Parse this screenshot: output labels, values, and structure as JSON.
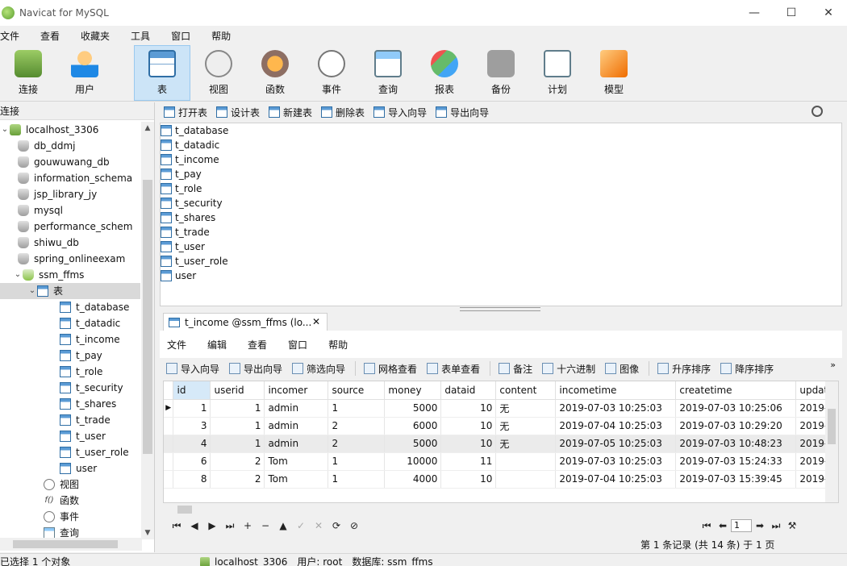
{
  "window": {
    "title": "Navicat for MySQL",
    "minimize": "—",
    "maximize": "☐",
    "close": "✕"
  },
  "menu": [
    "文件",
    "查看",
    "收藏夹",
    "工具",
    "窗口",
    "帮助"
  ],
  "toolbar": [
    {
      "label": "连接",
      "icon": "connection-icon"
    },
    {
      "label": "用户",
      "icon": "user-icon"
    },
    {
      "label": "表",
      "icon": "table-icon"
    },
    {
      "label": "视图",
      "icon": "view-icon"
    },
    {
      "label": "函数",
      "icon": "function-icon"
    },
    {
      "label": "事件",
      "icon": "event-icon"
    },
    {
      "label": "查询",
      "icon": "query-icon"
    },
    {
      "label": "报表",
      "icon": "report-icon"
    },
    {
      "label": "备份",
      "icon": "backup-icon"
    },
    {
      "label": "计划",
      "icon": "schedule-icon"
    },
    {
      "label": "模型",
      "icon": "model-icon"
    }
  ],
  "left_panel": {
    "header": "连接",
    "connection": "localhost_3306",
    "databases": [
      "db_ddmj",
      "gouwuwang_db",
      "information_schema",
      "jsp_library_jy",
      "mysql",
      "performance_schem",
      "shiwu_db",
      "spring_onlineexam"
    ],
    "open_db": "ssm_ffms",
    "tables_node": "表",
    "tables": [
      "t_database",
      "t_datadic",
      "t_income",
      "t_pay",
      "t_role",
      "t_security",
      "t_shares",
      "t_trade",
      "t_user",
      "t_user_role",
      "user"
    ],
    "other_nodes": [
      "视图",
      "函数",
      "事件",
      "查询"
    ]
  },
  "object_toolbar": [
    "打开表",
    "设计表",
    "新建表",
    "删除表",
    "导入向导",
    "导出向导"
  ],
  "object_list": [
    "t_database",
    "t_datadic",
    "t_income",
    "t_pay",
    "t_role",
    "t_security",
    "t_shares",
    "t_trade",
    "t_user",
    "t_user_role",
    "user"
  ],
  "tab": {
    "title": "t_income @ssm_ffms (lo...",
    "close": "✕"
  },
  "inner_menu": [
    "文件",
    "编辑",
    "查看",
    "窗口",
    "帮助"
  ],
  "grid_toolbar": [
    "导入向导",
    "导出向导",
    "筛选向导",
    "网格查看",
    "表单查看",
    "备注",
    "十六进制",
    "图像",
    "升序排序",
    "降序排序"
  ],
  "grid": {
    "columns": [
      "id",
      "userid",
      "incomer",
      "source",
      "money",
      "dataid",
      "content",
      "incometime",
      "createtime",
      "updat"
    ],
    "rows": [
      {
        "id": "1",
        "userid": "1",
        "incomer": "admin",
        "source": "1",
        "money": "5000",
        "dataid": "10",
        "content": "无",
        "incometime": "2019-07-03 10:25:03",
        "createtime": "2019-07-03 10:25:06",
        "update": "2019-0"
      },
      {
        "id": "3",
        "userid": "1",
        "incomer": "admin",
        "source": "2",
        "money": "6000",
        "dataid": "10",
        "content": "无",
        "incometime": "2019-07-04 10:25:03",
        "createtime": "2019-07-03 10:29:20",
        "update": "2019-0"
      },
      {
        "id": "4",
        "userid": "1",
        "incomer": "admin",
        "source": "2",
        "money": "5000",
        "dataid": "10",
        "content": "无",
        "incometime": "2019-07-05 10:25:03",
        "createtime": "2019-07-03 10:48:23",
        "update": "2019-0"
      },
      {
        "id": "6",
        "userid": "2",
        "incomer": "Tom",
        "source": "1",
        "money": "10000",
        "dataid": "11",
        "content": "",
        "incometime": "2019-07-03 10:25:03",
        "createtime": "2019-07-03 15:24:33",
        "update": "2019-0"
      },
      {
        "id": "8",
        "userid": "2",
        "incomer": "Tom",
        "source": "1",
        "money": "4000",
        "dataid": "10",
        "content": "",
        "incometime": "2019-07-04 10:25:03",
        "createtime": "2019-07-03 15:39:45",
        "update": "2019-0"
      }
    ]
  },
  "pagination": {
    "page": "1"
  },
  "record_info": "第 1 条记录 (共 14 条) 于 1 页",
  "status": {
    "selection": "已选择 1 个对象",
    "connection": "localhost_3306",
    "user": "用户: root",
    "database": "数据库: ssm_ffms"
  }
}
